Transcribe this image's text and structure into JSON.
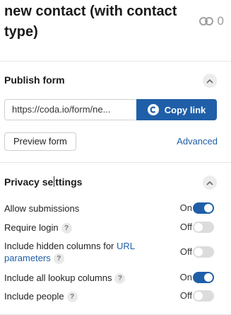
{
  "header": {
    "title": "new contact (with contact type)",
    "link_count": "0"
  },
  "publish": {
    "title": "Publish form",
    "url": "https://coda.io/form/ne...",
    "copy_label": "Copy link",
    "preview_label": "Preview form",
    "advanced_label": "Advanced"
  },
  "privacy": {
    "title_part1": "Privacy se",
    "title_part2": "ttings",
    "rows": [
      {
        "label": "Allow submissions",
        "state": "On"
      },
      {
        "label": "Require login",
        "state": "Off"
      },
      {
        "label_pre": "Include hidden columns for ",
        "label_link": "URL parameters",
        "state": "Off"
      },
      {
        "label": "Include all lookup columns",
        "state": "On"
      },
      {
        "label": "Include people",
        "state": "Off"
      }
    ],
    "help_glyph": "?"
  },
  "colors": {
    "accent": "#1f5fa8",
    "toggle_off": "#dcdcdc"
  }
}
